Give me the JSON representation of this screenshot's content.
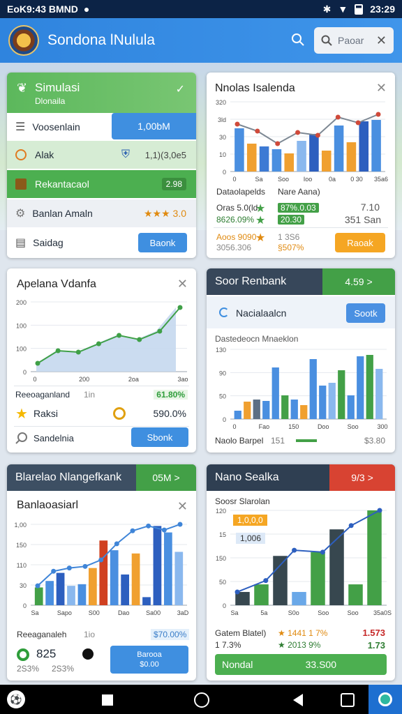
{
  "status": {
    "left": "EoK9:43 BMND",
    "time": "23:29"
  },
  "appbar": {
    "title": "Sondona lNulula",
    "search_placeholder": "Paoar"
  },
  "card1": {
    "header": "Simulasi",
    "header_sub": "Dlonaila",
    "rows": [
      {
        "label": "Voosenlain",
        "value": "1,00bM"
      },
      {
        "label": "Alak",
        "value": "1,1)(3,0e5"
      },
      {
        "label": "Rekantacaol",
        "value": "2.98"
      },
      {
        "label": "Banlan Amaln",
        "value": "★★★ 3.0"
      },
      {
        "label": "Saidag",
        "value": "Baonk"
      }
    ]
  },
  "card2": {
    "title": "Nnolas Isalenda",
    "yticks": [
      "320",
      "3ld",
      "30",
      "10",
      "0"
    ],
    "xticks": [
      "0",
      "Sa",
      "Soo",
      "Ioo",
      "0a",
      "0 30",
      "35a6"
    ],
    "bars": [
      {
        "h": 0.62,
        "c": "#4a8fe0"
      },
      {
        "h": 0.4,
        "c": "#f0a030"
      },
      {
        "h": 0.36,
        "c": "#3d7ad4"
      },
      {
        "h": 0.32,
        "c": "#4a8fe0"
      },
      {
        "h": 0.26,
        "c": "#f0a030"
      },
      {
        "h": 0.44,
        "c": "#8ab8ee"
      },
      {
        "h": 0.54,
        "c": "#2d5fbf"
      },
      {
        "h": 0.3,
        "c": "#f0a030"
      },
      {
        "h": 0.66,
        "c": "#4a8fe0"
      },
      {
        "h": 0.42,
        "c": "#f0a030"
      },
      {
        "h": 0.72,
        "c": "#2d5fbf"
      },
      {
        "h": 0.74,
        "c": "#4a8fe0"
      }
    ],
    "line": [
      0.68,
      0.58,
      0.4,
      0.56,
      0.52,
      0.78,
      0.7,
      0.82
    ],
    "stat_head": [
      "Dataolapelds",
      "Nare Aana)"
    ],
    "stats": [
      {
        "a": "Oras 5.0(ld",
        "b": "87%.0.03",
        "c": "7.10"
      },
      {
        "a": "8626.09%",
        "b": "20.30",
        "c": "351 San"
      },
      {
        "a": "Aoos 9090",
        "b": "1 3S6",
        "c": ""
      },
      {
        "a": "3056.306",
        "b": "§507%",
        "c": ""
      }
    ],
    "button": "Raoak"
  },
  "card3": {
    "title": "Apelana Vdanfa",
    "yticks": [
      "200",
      "100",
      "100",
      "0"
    ],
    "xticks": [
      "0",
      "200",
      "2oa",
      "3ao"
    ],
    "line": [
      0.12,
      0.3,
      0.28,
      0.4,
      0.52,
      0.46,
      0.58,
      0.92
    ],
    "rows": [
      {
        "label": "Reeoaganland",
        "mid": "1in",
        "value": "61.80%"
      },
      {
        "label": "Raksi",
        "mid": "",
        "value": "590.0%"
      },
      {
        "label": "Sandelnia",
        "mid": "",
        "value": "Sbonk"
      }
    ]
  },
  "card4": {
    "header": "Soor Renbank",
    "header_value": "4.59 >",
    "search_label": "Nacialaalcn",
    "search_button": "Sootk",
    "subtitle": "Dastedeocn Mnaeklon",
    "yticks": [
      "130",
      "90",
      "50",
      "0"
    ],
    "xticks": [
      "0",
      "Fao",
      "150",
      "Doo",
      "Soo",
      "300"
    ],
    "bars": [
      {
        "h": 0.12,
        "c": "#4a8fe0"
      },
      {
        "h": 0.25,
        "c": "#f0a030"
      },
      {
        "h": 0.28,
        "c": "#5c6f85"
      },
      {
        "h": 0.26,
        "c": "#4a8fe0"
      },
      {
        "h": 0.74,
        "c": "#4a8fe0"
      },
      {
        "h": 0.34,
        "c": "#43a047"
      },
      {
        "h": 0.28,
        "c": "#4a8fe0"
      },
      {
        "h": 0.2,
        "c": "#f0a030"
      },
      {
        "h": 0.86,
        "c": "#4a8fe0"
      },
      {
        "h": 0.48,
        "c": "#4a8fe0"
      },
      {
        "h": 0.52,
        "c": "#8ab8ee"
      },
      {
        "h": 0.7,
        "c": "#43a047"
      },
      {
        "h": 0.34,
        "c": "#4a8fe0"
      },
      {
        "h": 0.9,
        "c": "#4a8fe0"
      },
      {
        "h": 0.92,
        "c": "#43a047"
      },
      {
        "h": 0.72,
        "c": "#8ab8ee"
      }
    ],
    "footer_label": "Naolo Barpel",
    "footer_mid": "151",
    "footer_value": "$3.80"
  },
  "card5": {
    "header": "Blarelao Nlangefkank",
    "header_value": "05M >",
    "title": "Banlaoasiarl",
    "yticks": [
      "1,00",
      "150",
      "110",
      "30",
      "0"
    ],
    "xticks": [
      "Sa",
      "Sapo",
      "S00",
      "Dao",
      "Sa00",
      "3aD"
    ],
    "bars": [
      {
        "h": 0.22,
        "c": "#43a047"
      },
      {
        "h": 0.3,
        "c": "#4a8fe0"
      },
      {
        "h": 0.4,
        "c": "#2d5fbf"
      },
      {
        "h": 0.24,
        "c": "#8ab8ee"
      },
      {
        "h": 0.26,
        "c": "#4a8fe0"
      },
      {
        "h": 0.46,
        "c": "#f0a030"
      },
      {
        "h": 0.8,
        "c": "#d04020"
      },
      {
        "h": 0.68,
        "c": "#4a8fe0"
      },
      {
        "h": 0.38,
        "c": "#2d5fbf"
      },
      {
        "h": 0.64,
        "c": "#f0a030"
      },
      {
        "h": 0.1,
        "c": "#2d5fbf"
      },
      {
        "h": 0.98,
        "c": "#2d5fbf"
      },
      {
        "h": 0.9,
        "c": "#4a8fe0"
      },
      {
        "h": 0.66,
        "c": "#8ab8ee"
      }
    ],
    "line": [
      0.24,
      0.42,
      0.46,
      0.48,
      0.56,
      0.76,
      0.92,
      0.98,
      0.93,
      1.0
    ],
    "stat_label": "Reeaganaleh",
    "stat_mid": "1io",
    "stat_value": "$70.00%",
    "big_value": "825",
    "sub_a": "2S3%",
    "sub_b": "2S3%",
    "button_line1": "Barooa",
    "button_line2": "$0.00"
  },
  "card6": {
    "header": "Nano Sealka",
    "header_value": "9/3 >",
    "subtitle": "Soosr Slarolan",
    "badge": "1,0,0,0",
    "legend": "1,006",
    "yticks": [
      "120",
      "15",
      "150",
      "50",
      "0"
    ],
    "xticks": [
      "Sa",
      "5a",
      "S0o",
      "Soo",
      "Soo",
      "35a0S"
    ],
    "bars": [
      {
        "h": 0.14,
        "c": "#37474f"
      },
      {
        "h": 0.22,
        "c": "#43a047"
      },
      {
        "h": 0.52,
        "c": "#37474f"
      },
      {
        "h": 0.14,
        "c": "#6aa8e8"
      },
      {
        "h": 0.56,
        "c": "#43a047"
      },
      {
        "h": 0.8,
        "c": "#37474f"
      },
      {
        "h": 0.22,
        "c": "#43a047"
      },
      {
        "h": 1.0,
        "c": "#43a047"
      }
    ],
    "line": [
      0.14,
      0.26,
      0.58,
      0.56,
      0.84,
      1.0
    ],
    "stats": [
      {
        "a": "Gatem Blatel)",
        "b": "★ 1441 1 7%",
        "c": "1.573"
      },
      {
        "a": "1 7.3%",
        "b": "★ 2013 9%",
        "c": "1.73"
      }
    ],
    "button": "Nondal",
    "button_value": "33.S00"
  }
}
